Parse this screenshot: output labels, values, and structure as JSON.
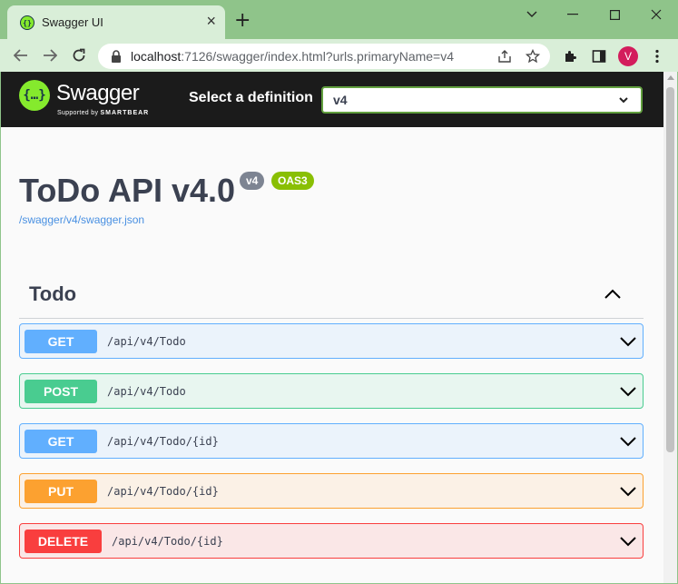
{
  "browser": {
    "tab_title": "Swagger UI",
    "url_host": "localhost",
    "url_rest": ":7126/swagger/index.html?urls.primaryName=v4",
    "profile_initial": "V"
  },
  "swagger": {
    "brand": "Swagger",
    "brand_sub_prefix": "Supported by",
    "brand_sub_name": "SMARTBEAR",
    "select_label": "Select a definition",
    "selected_definition": "v4",
    "title": "ToDo API v4.0",
    "version_badge": "v4",
    "oas_badge": "OAS3",
    "spec_link": "/swagger/v4/swagger.json",
    "tag": "Todo",
    "operations": [
      {
        "method": "GET",
        "path": "/api/v4/Todo"
      },
      {
        "method": "POST",
        "path": "/api/v4/Todo"
      },
      {
        "method": "GET",
        "path": "/api/v4/Todo/{id}"
      },
      {
        "method": "PUT",
        "path": "/api/v4/Todo/{id}"
      },
      {
        "method": "DELETE",
        "path": "/api/v4/Todo/{id}"
      }
    ]
  },
  "colors": {
    "get": "#61affe",
    "post": "#49cc90",
    "put": "#fca130",
    "delete": "#f93e3e",
    "header": "#1b1b1b",
    "chrome": "#8fc48a"
  }
}
